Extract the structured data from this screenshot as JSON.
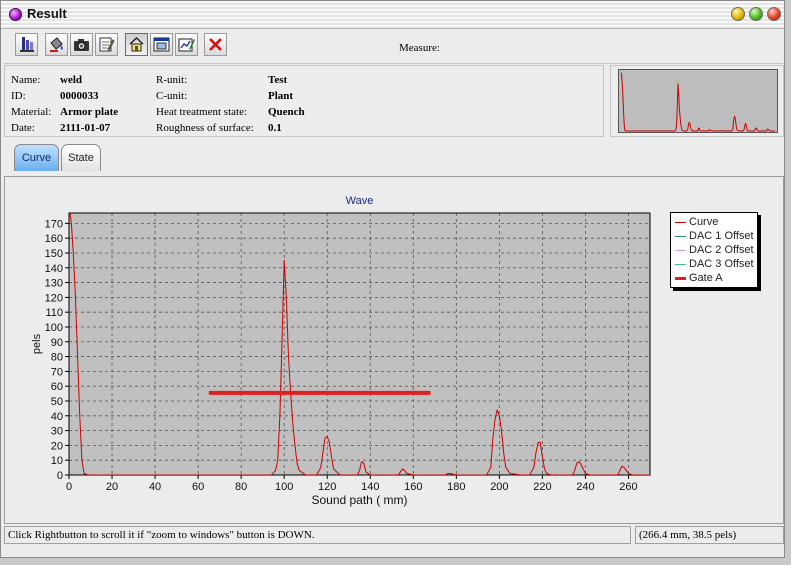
{
  "window": {
    "title": "Result"
  },
  "toolbar": {
    "measure_label": "Measure:",
    "buttons": [
      {
        "icon": "print-icon"
      },
      {
        "icon": "paint-bucket-icon"
      },
      {
        "icon": "camera-icon"
      },
      {
        "icon": "notepad-icon"
      },
      {
        "icon": "home-icon",
        "pressed": true
      },
      {
        "icon": "zoom-to-window-icon"
      },
      {
        "icon": "edit-chart-icon"
      },
      {
        "icon": "close-x-icon"
      }
    ]
  },
  "info": {
    "name_label": "Name:",
    "name_value": "weld",
    "id_label": "ID:",
    "id_value": "0000033",
    "material_label": "Material:",
    "material_value": "Armor plate",
    "date_label": "Date:",
    "date_value": "2111-01-07",
    "runit_label": "R-unit:",
    "runit_value": "Test",
    "cunit_label": "C-unit:",
    "cunit_value": "Plant",
    "heat_label": "Heat treatment state:",
    "heat_value": "Quench",
    "rough_label": "Roughness of surface:",
    "rough_value": "0.1"
  },
  "tabs": {
    "curve": "Curve",
    "state": "State"
  },
  "chart_data": {
    "type": "line",
    "title": "Wave",
    "xlabel": "Sound path ( mm)",
    "ylabel": "pels",
    "xlim": [
      0,
      270
    ],
    "ylim": [
      0,
      177
    ],
    "x_ticks": [
      0,
      20,
      40,
      60,
      80,
      100,
      120,
      140,
      160,
      180,
      200,
      220,
      240,
      260
    ],
    "y_ticks": [
      0,
      10,
      20,
      30,
      40,
      50,
      60,
      70,
      80,
      90,
      100,
      110,
      120,
      130,
      140,
      150,
      160,
      170
    ],
    "grid": true,
    "legend_position": "right",
    "background": "#c0c0c0",
    "series": [
      {
        "name": "Curve",
        "color": "#cc0000",
        "x": [
          0.0,
          0.6,
          1.2,
          2.0,
          3.0,
          4.0,
          5.0,
          6.0,
          7.0,
          9.0,
          20.0,
          40.0,
          60.0,
          80.0,
          94.0,
          96.0,
          97.0,
          98.0,
          99.0,
          100.0,
          101.0,
          102.0,
          103.0,
          104.0,
          105.0,
          106.0,
          107.0,
          110.0,
          115.0,
          117.0,
          118.0,
          119.0,
          120.0,
          121.0,
          122.0,
          123.0,
          126.0,
          134.0,
          135.0,
          136.0,
          137.0,
          138.0,
          140.0,
          153.0,
          154.0,
          155.0,
          156.0,
          157.0,
          160.0,
          175.0,
          176.0,
          177.0,
          180.0,
          194.0,
          196.0,
          197.0,
          198.0,
          199.0,
          200.0,
          201.0,
          202.0,
          203.0,
          205.0,
          210.0,
          214.0,
          216.0,
          217.0,
          218.0,
          219.0,
          220.0,
          221.0,
          222.0,
          224.0,
          230.0,
          234.0,
          235.0,
          236.0,
          237.0,
          238.0,
          239.0,
          240.0,
          242.0,
          250.0,
          255.0,
          256.0,
          257.0,
          258.0,
          259.0,
          260.0,
          262.0,
          270.0
        ],
        "y": [
          178,
          176,
          168,
          150,
          120,
          80,
          40,
          10,
          1,
          0,
          0,
          0,
          0,
          0,
          0,
          3,
          10,
          40,
          90,
          145,
          120,
          80,
          55,
          35,
          20,
          8,
          3,
          0,
          0,
          5,
          15,
          25,
          26,
          22,
          12,
          4,
          0,
          0,
          3,
          9,
          8,
          2,
          0,
          0,
          2,
          4,
          3,
          1,
          0,
          0,
          1,
          1,
          0,
          0,
          5,
          25,
          38,
          44,
          40,
          30,
          15,
          5,
          1,
          0,
          0,
          5,
          15,
          22,
          22,
          12,
          4,
          1,
          0,
          0,
          0,
          3,
          8,
          9,
          7,
          4,
          1,
          0,
          0,
          0,
          3,
          6,
          5,
          3,
          1,
          0,
          0
        ]
      },
      {
        "name": "DAC 1 Offset",
        "color": "#2e8b7f",
        "x": [],
        "y": []
      },
      {
        "name": "DAC 2 Offset",
        "color": "#e6a0e6",
        "x": [],
        "y": []
      },
      {
        "name": "DAC 3 Offset",
        "color": "#3ac0a0",
        "x": [],
        "y": []
      },
      {
        "name": "Gate A",
        "color": "#e02020",
        "x": [
          65,
          168
        ],
        "y": [
          55.5,
          55.5
        ]
      }
    ]
  },
  "status": {
    "hint": "Click Rightbutton to scroll it if  \"zoom to windows\" button is DOWN.",
    "coords": "(266.4 mm, 38.5 pels)"
  }
}
